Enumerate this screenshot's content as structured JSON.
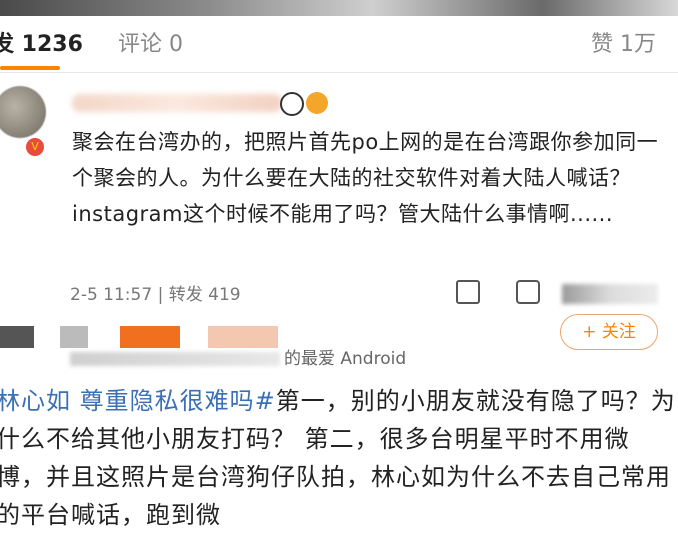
{
  "tabs": {
    "repost": "发 1236",
    "comment": "评论 0",
    "like": "赞 1万"
  },
  "post1": {
    "text": "聚会在台湾办的，把照片首先po上网的是在台湾跟你参加同一个聚会的人。为什么要在大陆的社交软件对着大陆人喊话？instagram这个时候不能用了吗？管大陆什么事情啊......",
    "time": "2-5 11:57",
    "repost_label": "转发 419"
  },
  "post2": {
    "source_suffix": "的最爱 Android",
    "follow_label": "+ 关注",
    "hashtag": "林心如 尊重隐私很难吗#",
    "text": "第一，别的小朋友就没有隐了吗？为什么不给其他小朋友打码？ 第二，很多台明星平时不用微博，并且这照片是台湾狗仔队拍，林心如为什么不去自己常用的平台喊话，跑到微"
  },
  "icons": [
    "edit-icon",
    "comment-icon"
  ],
  "colors": {
    "accent": "#ff8200",
    "hashtag": "#3b6fb6"
  }
}
